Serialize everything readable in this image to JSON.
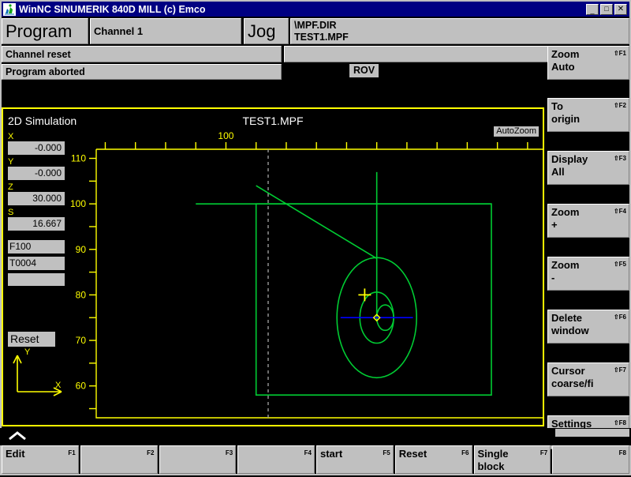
{
  "window": {
    "title": "WinNC SINUMERIK 840D MILL (c) Emco",
    "icon": "app-icon",
    "minimize_label": "_",
    "maximize_label": "□",
    "close_label": "✕",
    "titlebar_color": "#000082"
  },
  "header": {
    "mode_label": "Program",
    "channel_label": "Channel 1",
    "operating_mode": "Jog",
    "program_dir": "\\MPF.DIR",
    "program_name": "TEST1.MPF",
    "channel_status": "Channel reset",
    "program_status": "Program aborted",
    "rov_badge": "ROV"
  },
  "softkeys_right": [
    {
      "line1": "Zoom",
      "line2": "Auto",
      "fkey": "⇧F1"
    },
    {
      "line1": "To",
      "line2": "origin",
      "fkey": "⇧F2"
    },
    {
      "line1": "Display",
      "line2": "All",
      "fkey": "⇧F3"
    },
    {
      "line1": "Zoom",
      "line2": "+",
      "fkey": "⇧F4"
    },
    {
      "line1": "Zoom",
      "line2": "-",
      "fkey": "⇧F5"
    },
    {
      "line1": "Delete",
      "line2": "window",
      "fkey": "⇧F6"
    },
    {
      "line1": "Cursor",
      "line2": "coarse/fi",
      "fkey": "⇧F7"
    },
    {
      "line1": "Settings",
      "line2": "",
      "fkey": "⇧F8"
    }
  ],
  "softkeys_bottom": [
    {
      "line1": "Edit",
      "line2": "",
      "fkey": "F1"
    },
    {
      "line1": "",
      "line2": "",
      "fkey": "F2"
    },
    {
      "line1": "",
      "line2": "",
      "fkey": "F3"
    },
    {
      "line1": "",
      "line2": "",
      "fkey": "F4"
    },
    {
      "line1": "start",
      "line2": "",
      "fkey": "F5"
    },
    {
      "line1": "Reset",
      "line2": "",
      "fkey": "F6"
    },
    {
      "line1": "Single",
      "line2": "block",
      "fkey": "F7"
    },
    {
      "line1": "",
      "line2": "",
      "fkey": "F8"
    }
  ],
  "simulation": {
    "window_title": "2D Simulation",
    "file_name": "TEST1.MPF",
    "autozoom_badge": "AutoZoom",
    "border_color": "#ffff00",
    "path_color": "#00cc33",
    "axis_color": "#ffff00",
    "cursor_color": "#ffff00",
    "axes_indicator": {
      "x": "X",
      "y": "Y"
    },
    "values": [
      {
        "label": "X",
        "value": "-0.000"
      },
      {
        "label": "Y",
        "value": "-0.000"
      },
      {
        "label": "Z",
        "value": "30.000"
      },
      {
        "label": "S",
        "value": "16.667"
      }
    ],
    "feed": "F100",
    "tool": "T0004",
    "aux_field": "",
    "status_field": "Reset"
  },
  "chart_data": {
    "type": "line",
    "title": "2D Simulation toolpath TEST1.MPF",
    "xlabel": "X",
    "ylabel": "Y",
    "grid": false,
    "x_ticks": [
      60,
      70,
      80,
      90,
      100,
      110,
      120,
      130,
      140,
      150,
      160,
      170,
      180,
      190,
      200
    ],
    "x_tick_labels": {
      "100": "100"
    },
    "y_ticks": [
      55,
      60,
      65,
      70,
      75,
      80,
      85,
      90,
      95,
      100,
      105,
      110
    ],
    "y_tick_labels": {
      "60": "60",
      "70": "70",
      "80": "80",
      "90": "90",
      "100": "100",
      "110": "110"
    },
    "xlim": [
      57,
      205
    ],
    "ylim": [
      53,
      112
    ],
    "series": [
      {
        "name": "stock-rectangle",
        "kind": "rect",
        "color": "#00cc33",
        "x": 110,
        "y": 58,
        "width": 78,
        "height": 42
      },
      {
        "name": "rapid-horizontal-line",
        "kind": "polyline",
        "color": "#00cc33",
        "points": [
          [
            90,
            100
          ],
          [
            188,
            100
          ]
        ]
      },
      {
        "name": "rapid-vertical-line",
        "kind": "polyline",
        "color": "#00cc33",
        "points": [
          [
            150,
            107
          ],
          [
            150,
            75
          ]
        ]
      },
      {
        "name": "approach-diagonal",
        "kind": "polyline",
        "color": "#00cc33",
        "points": [
          [
            110,
            104
          ],
          [
            150,
            88
          ]
        ]
      },
      {
        "name": "outer-circle",
        "kind": "circle",
        "color": "#00cc33",
        "cx": 150,
        "cy": 75,
        "r": 13.2
      },
      {
        "name": "middle-circle",
        "kind": "circle",
        "color": "#00cc33",
        "cx": 150,
        "cy": 75,
        "r": 5.6
      },
      {
        "name": "inner-circle",
        "kind": "circle",
        "color": "#00cc33",
        "cx": 152.8,
        "cy": 75,
        "r": 2.8
      },
      {
        "name": "dashed-reference-line",
        "kind": "polyline",
        "color": "#9a9a9a",
        "dashed": true,
        "points": [
          [
            114,
            112
          ],
          [
            114,
            53
          ]
        ]
      },
      {
        "name": "centerline",
        "kind": "polyline",
        "color": "#0000ff",
        "points": [
          [
            138,
            75
          ],
          [
            162,
            75
          ]
        ]
      },
      {
        "name": "tool-cursor",
        "kind": "crosshair",
        "color": "#ffff00",
        "x": 146,
        "y": 80
      },
      {
        "name": "origin-marker",
        "kind": "diamond",
        "color": "#ffff00",
        "x": 150,
        "y": 75
      }
    ]
  }
}
